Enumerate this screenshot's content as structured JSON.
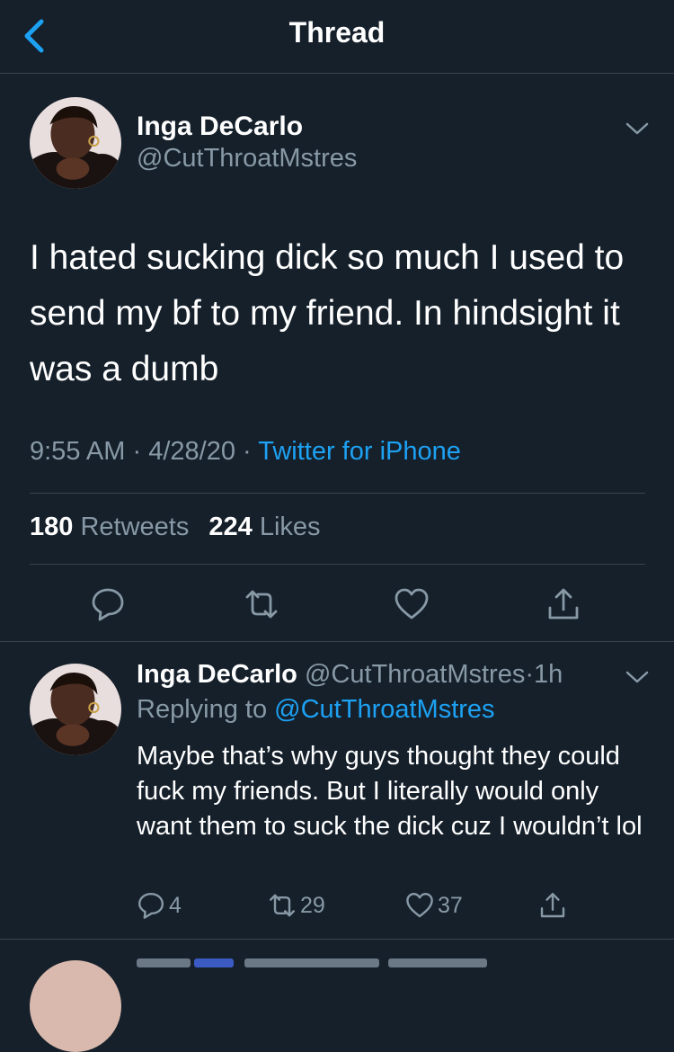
{
  "header": {
    "title": "Thread"
  },
  "main_tweet": {
    "display_name": "Inga DeCarlo",
    "handle": "@CutThroatMstres",
    "text": "I hated sucking dick so much I used to send my bf to my friend. In hindsight it was a dumb",
    "time": "9:55 AM",
    "date": "4/28/20",
    "separator": "·",
    "source": "Twitter for iPhone",
    "retweet_count": "180",
    "retweet_label": "Retweets",
    "like_count": "224",
    "like_label": "Likes"
  },
  "reply_tweet": {
    "display_name": "Inga DeCarlo",
    "handle": "@CutThroatMstres",
    "separator": "·",
    "age": "1h",
    "replying_label": "Replying to",
    "replying_to": "@CutThroatMstres",
    "text": "Maybe that’s why guys thought they could fuck my friends. But I literally would only want them to suck the dick cuz I wouldn’t lol",
    "reply_count": "4",
    "retweet_count": "29",
    "like_count": "37"
  },
  "colors": {
    "background": "#15202b",
    "text_primary": "#ffffff",
    "text_secondary": "#8899a6",
    "accent": "#1da1f2",
    "divider": "#38444d"
  },
  "icons": {
    "back": "chevron-left-icon",
    "more": "chevron-down-icon",
    "reply": "speech-bubble-icon",
    "retweet": "retweet-arrows-icon",
    "like": "heart-icon",
    "share": "share-upload-icon"
  }
}
